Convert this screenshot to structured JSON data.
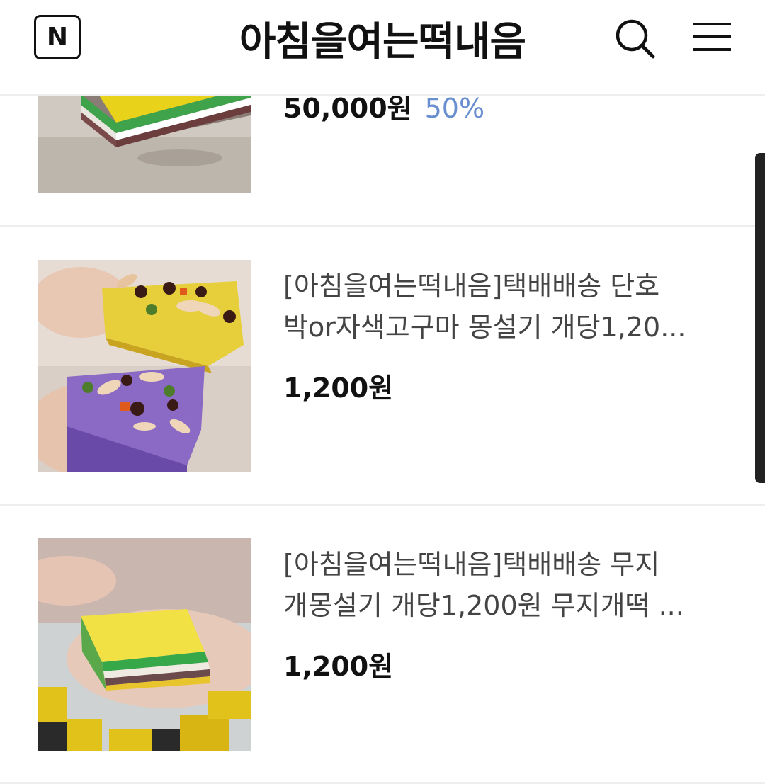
{
  "header": {
    "logo_label": "N",
    "title": "아침을여는떡내음",
    "search_icon": "search-icon",
    "menu_icon": "hamburger-menu-icon"
  },
  "products": [
    {
      "price": "50,000원",
      "discount": "50%"
    },
    {
      "title_line1": "[아침을여는떡내음]택배배송 단호",
      "title_line2": "박or자색고구마 몽설기 개당1,20...",
      "price": "1,200원"
    },
    {
      "title_line1": "[아침을여는떡내음]택배배송 무지",
      "title_line2": "개몽설기 개당1,200원 무지개떡 ...",
      "price": "1,200원"
    }
  ],
  "colors": {
    "discount": "#6a8fd0",
    "divider": "#eeeeee",
    "text_primary": "#111111",
    "text_secondary": "#444444"
  }
}
